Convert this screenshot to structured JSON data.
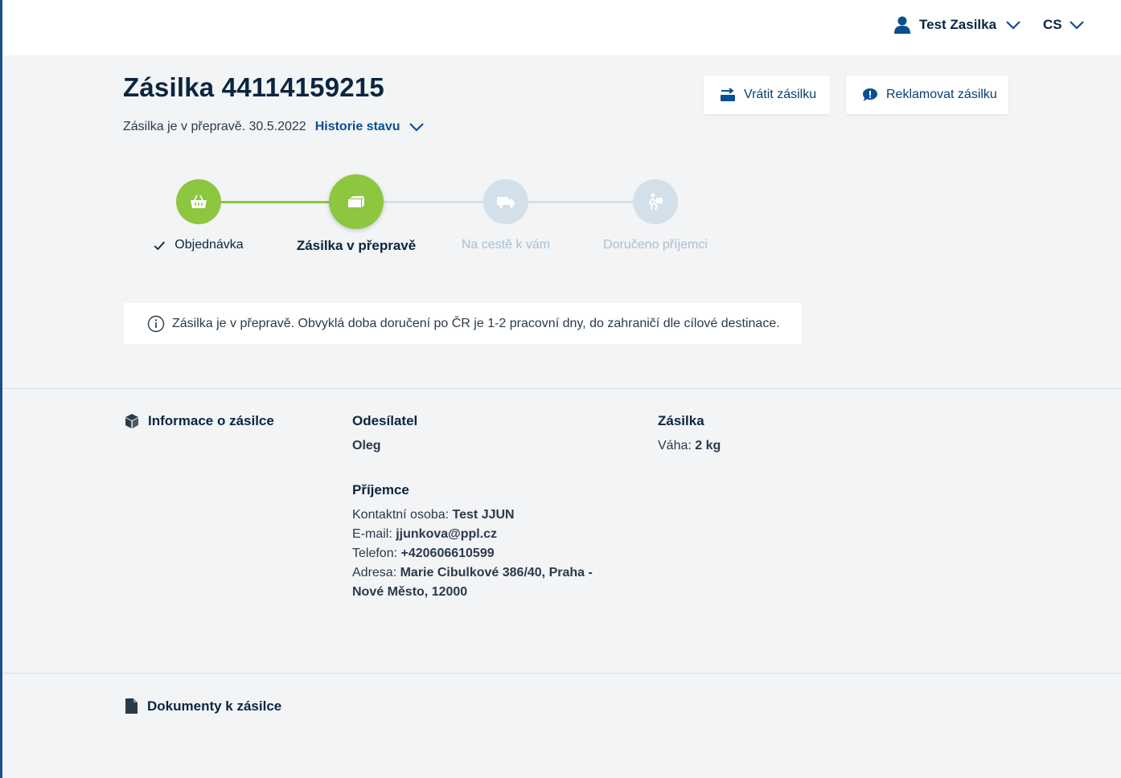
{
  "header": {
    "user_name": "Test Zasilka",
    "language": "CS"
  },
  "shipment": {
    "title": "Zásilka 44114159215",
    "status_text": "Zásilka je v přepravě. 30.5.2022",
    "history_link": "Historie stavu"
  },
  "actions": {
    "return_label": "Vrátit zásilku",
    "complaint_label": "Reklamovat zásilku"
  },
  "progress": {
    "steps": [
      {
        "label": "Objednávka",
        "state": "done",
        "icon": "basket-icon"
      },
      {
        "label": "Zásilka v přepravě",
        "state": "current",
        "icon": "package-icon"
      },
      {
        "label": "Na cestě k vám",
        "state": "pending",
        "icon": "truck-icon"
      },
      {
        "label": "Doručeno příjemci",
        "state": "pending",
        "icon": "delivery-person-icon"
      }
    ],
    "colors": {
      "done": "#8dc63f",
      "pending": "#d3e0ea",
      "pending_text": "#a9bfd0"
    }
  },
  "info_message": "Zásilka je v přepravě. Obvyklá doba doručení po ČR je 1-2 pracovní dny, do zahraničí dle cílové destinace.",
  "details": {
    "section_title": "Informace o zásilce",
    "sender": {
      "heading": "Odesílatel",
      "name": "Oleg"
    },
    "recipient": {
      "heading": "Příjemce",
      "contact_label": "Kontaktní osoba:",
      "contact_value": "Test JJUN",
      "email_label": "E-mail:",
      "email_value": "jjunkova@ppl.cz",
      "phone_label": "Telefon:",
      "phone_value": "+420606610599",
      "address_label": "Adresa:",
      "address_value_line1": "Marie Cibulkové 386/40, Praha -",
      "address_value_line2": "Nové Město, 12000"
    },
    "package": {
      "heading": "Zásilka",
      "weight_label": "Váha:",
      "weight_value": "2 kg"
    }
  },
  "documents": {
    "section_title": "Dokumenty k zásilce"
  }
}
